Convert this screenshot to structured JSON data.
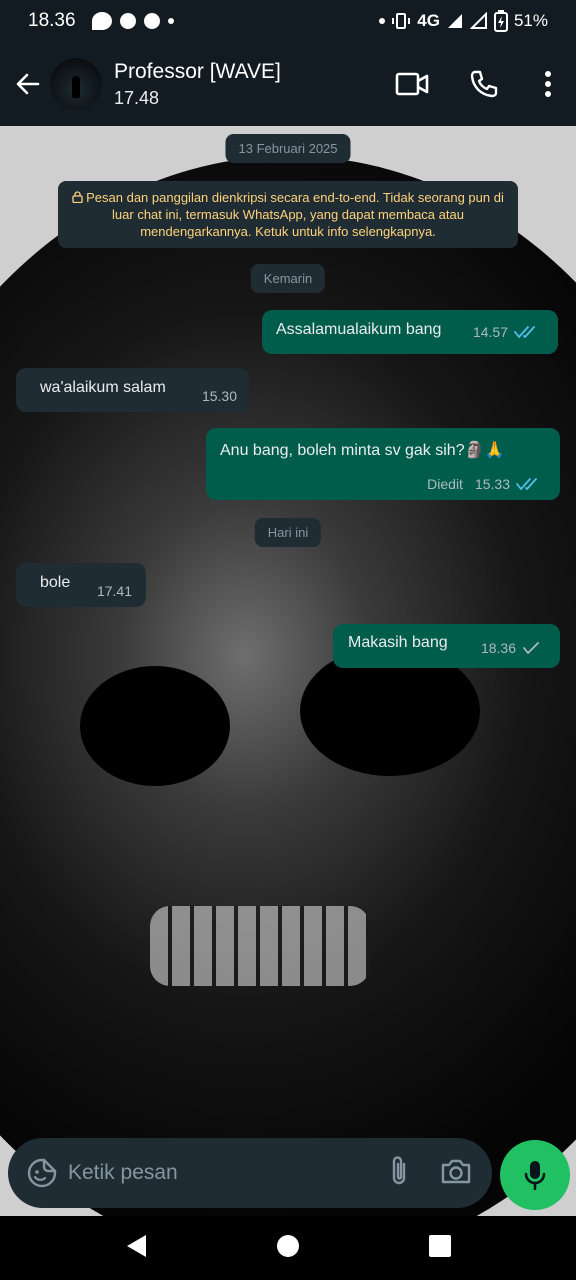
{
  "status_bar": {
    "time": "18.36",
    "network": "4G",
    "battery": "51%"
  },
  "header": {
    "contact_name": "Professor [WAVE]",
    "last_seen": "17.48"
  },
  "chat": {
    "date_label": "13 Februari 2025",
    "encryption_notice": "Pesan dan panggilan dienkripsi secara end-to-end. Tidak seorang pun di luar chat ini, termasuk WhatsApp, yang dapat membaca atau mendengarkannya. Ketuk untuk info selengkapnya.",
    "day_yesterday": "Kemarin",
    "day_today": "Hari ini",
    "messages": [
      {
        "direction": "out",
        "text": "Assalamualaikum bang",
        "time": "14.57",
        "status": "read"
      },
      {
        "direction": "in",
        "text": "wa'alaikum salam",
        "time": "15.30"
      },
      {
        "direction": "out",
        "text": "Anu bang, boleh minta sv gak sih?🗿🙏",
        "edited_label": "Diedit",
        "time": "15.33",
        "status": "read"
      },
      {
        "direction": "in",
        "text": "bole",
        "time": "17.41"
      },
      {
        "direction": "out",
        "text": "Makasih bang",
        "time": "18.36",
        "status": "sent"
      }
    ]
  },
  "input": {
    "placeholder": "Ketik pesan"
  },
  "colors": {
    "outgoing_bubble": "#005c4b",
    "incoming_bubble": "#202c33",
    "read_ticks": "#53bdeb",
    "mic_button": "#21c063",
    "notice_text": "#ffd279"
  }
}
